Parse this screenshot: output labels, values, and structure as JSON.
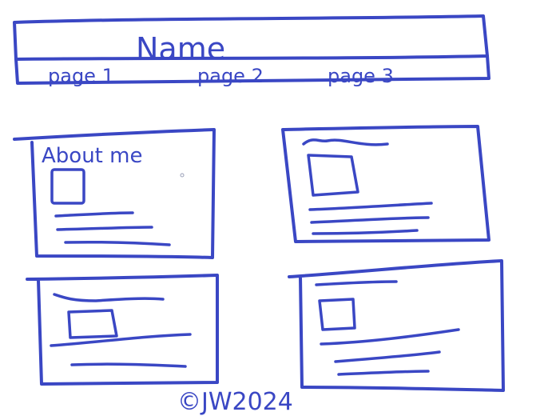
{
  "header": {
    "title": "Name",
    "nav": [
      "page 1",
      "page 2",
      "page 3"
    ]
  },
  "cards": [
    {
      "heading": "About me"
    },
    {
      "heading": ""
    },
    {
      "heading": ""
    },
    {
      "heading": ""
    }
  ],
  "footer": {
    "text": "©JW2024"
  },
  "colors": {
    "ink": "#3a47c4",
    "background": "#ffffff"
  }
}
